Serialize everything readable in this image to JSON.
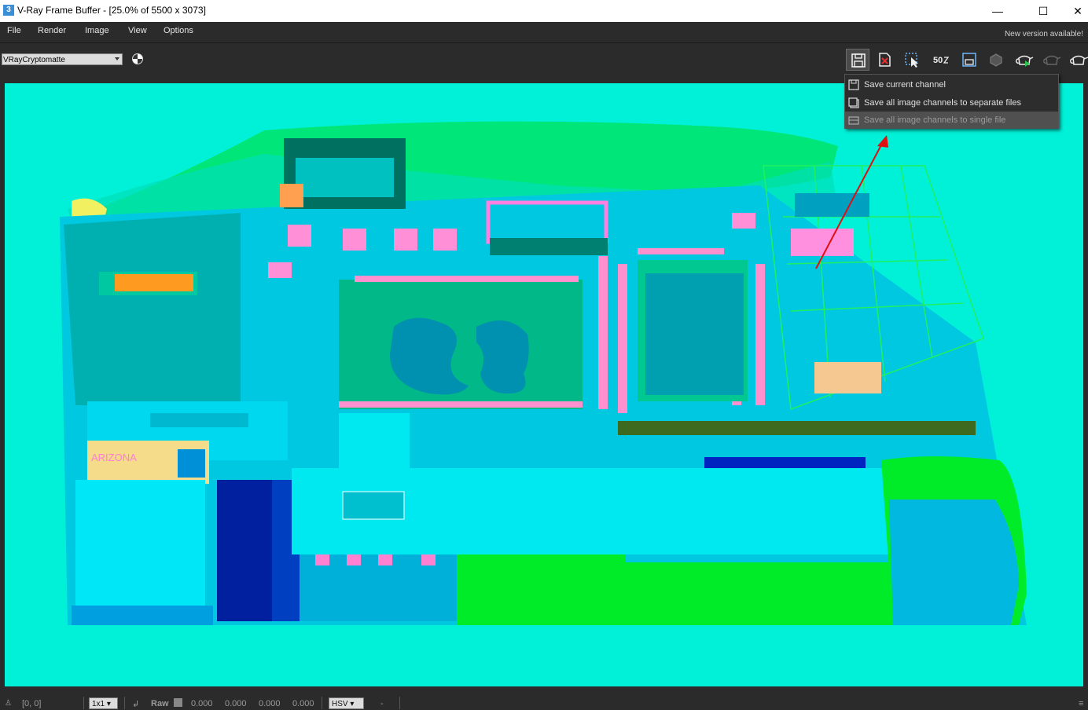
{
  "window": {
    "icon_glyph": "3",
    "title": "V-Ray Frame Buffer - [25.0% of 5500 x 3073]",
    "minimize_glyph": "—",
    "maximize_glyph": "☐",
    "close_glyph": "✕"
  },
  "menu": {
    "items": [
      "File",
      "Render",
      "Image",
      "View",
      "Options"
    ],
    "notice": "New version available!"
  },
  "toolbar": {
    "channel_select_value": "VRayCryptomatte",
    "zoom_badge": "50",
    "icons": [
      "save-icon",
      "clear-image-icon",
      "track-mouse-icon",
      "zoom-50-icon",
      "region-render-icon",
      "interactive-render-icon",
      "render-teapot-icon",
      "stop-render-teapot-icon",
      "last-render-teapot-icon"
    ]
  },
  "save_menu": {
    "items": [
      {
        "label": "Save current channel",
        "icon": "save-single-icon"
      },
      {
        "label": "Save all image channels to separate files",
        "icon": "save-multiple-icon"
      },
      {
        "label": "Save all image channels to single file",
        "icon": "save-combined-icon"
      }
    ],
    "highlighted_index": 2
  },
  "render": {
    "signage": [
      "ARIZONA"
    ]
  },
  "annotation": {
    "arrow_color": "#e01010"
  },
  "status": {
    "coords": "[0, 0]",
    "zoom_mode": "1x1",
    "color_mode": "Raw",
    "r": "0.000",
    "g": "0.000",
    "b": "0.000",
    "a": "0.000",
    "color_space": "HSV",
    "hsv_value": "-"
  },
  "colors": {
    "viewport_bg": "#00f0d8",
    "panel_bg": "#2b2b2b"
  }
}
